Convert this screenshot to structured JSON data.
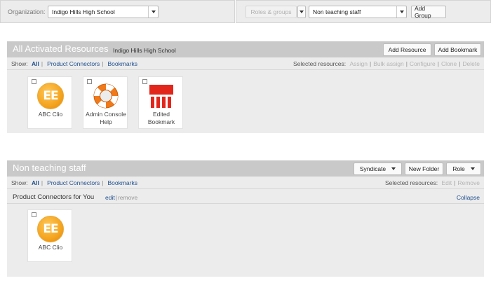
{
  "toolbar": {
    "org_label": "Organization:",
    "org_value": "Indigo Hills High School",
    "roles_groups_label": "Roles & groups",
    "group_value": "Non teaching staff",
    "add_group_label": "Add Group"
  },
  "activated": {
    "title": "All Activated Resources",
    "subtitle": "Indigo Hills High School",
    "add_resource_label": "Add Resource",
    "add_bookmark_label": "Add Bookmark",
    "show_label": "Show:",
    "filters": [
      "All",
      "Product Connectors",
      "Bookmarks"
    ],
    "selected_label": "Selected resources:",
    "actions": [
      "Assign",
      "Bulk assign",
      "Configure",
      "Clone",
      "Delete"
    ],
    "tiles": [
      {
        "label": "ABC Clio",
        "icon": "ee-icon",
        "icon_text": "EE"
      },
      {
        "label": "Admin Console Help",
        "icon": "lifebuoy-icon"
      },
      {
        "label": "Edited Bookmark",
        "icon": "bookmark-icon"
      }
    ]
  },
  "group_panel": {
    "title": "Non teaching staff",
    "syndicate_label": "Syndicate",
    "new_folder_label": "New Folder",
    "role_label": "Role",
    "show_label": "Show:",
    "filters": [
      "All",
      "Product Connectors",
      "Bookmarks"
    ],
    "selected_label": "Selected resources:",
    "actions": [
      "Edit",
      "Remove"
    ],
    "folder": {
      "name": "Product Connectors for You",
      "edit_label": "edit",
      "remove_label": "remove",
      "collapse_label": "Collapse"
    },
    "tiles": [
      {
        "label": "ABC Clio",
        "icon": "ee-icon",
        "icon_text": "EE"
      }
    ]
  },
  "colors": {
    "link": "#1f4f8f",
    "header_bg": "#c9c9c9",
    "panel_bg": "#ececec",
    "ee_orange": "#f4a41f",
    "lifebuoy_orange": "#f07a1a",
    "bookmark_red": "#e3261b"
  }
}
